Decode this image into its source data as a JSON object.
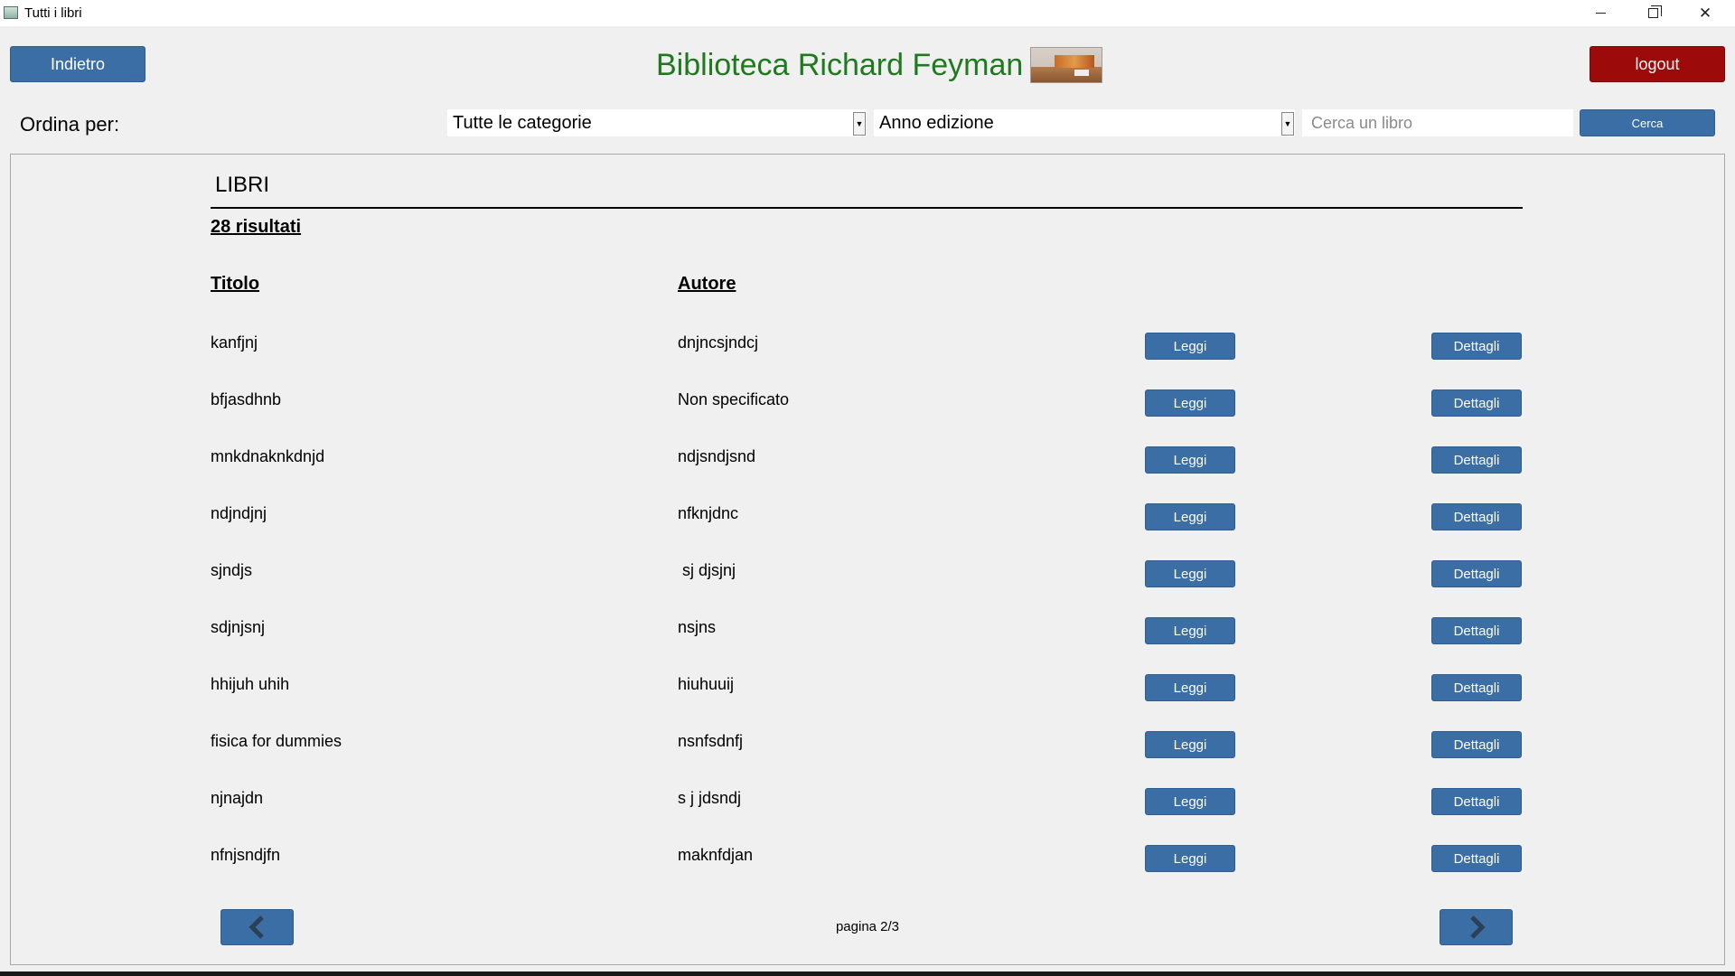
{
  "window": {
    "title": "Tutti i libri",
    "controls": [
      "minimize-icon",
      "maximize-icon",
      "close-icon"
    ]
  },
  "header": {
    "back_label": "Indietro",
    "brand_title": "Biblioteca Richard Feyman",
    "logout_label": "logout"
  },
  "filters": {
    "sort_label": "Ordina per:",
    "category_selected": "Tutte le categorie",
    "year_selected": "Anno edizione",
    "search_placeholder": "Cerca un libro",
    "search_value": "",
    "search_button": "Cerca"
  },
  "list": {
    "section_title": "LIBRI",
    "result_count": "28 risultati",
    "col_title": "Titolo",
    "col_author": "Autore",
    "read_label": "Leggi",
    "details_label": "Dettagli",
    "rows": [
      {
        "title": "kanfjnj",
        "author": "dnjncsjndcj"
      },
      {
        "title": "bfjasdhnb",
        "author": "Non specificato"
      },
      {
        "title": "mnkdnaknkdnjd",
        "author": "ndjsndjsnd"
      },
      {
        "title": "ndjndjnj",
        "author": "nfknjdnc"
      },
      {
        "title": "sjndjs",
        "author": " sj djsjnj"
      },
      {
        "title": "sdjnjsnj",
        "author": "nsjns"
      },
      {
        "title": "hhijuh uhih",
        "author": "hiuhuuij"
      },
      {
        "title": "fisica for dummies",
        "author": "nsnfsdnfj"
      },
      {
        "title": "njnajdn",
        "author": "s j jdsndj"
      },
      {
        "title": "nfnjsndjfn",
        "author": "maknfdjan"
      }
    ]
  },
  "pagination": {
    "page_text": "pagina 2/3",
    "prev_icon": "chevron-left-icon",
    "next_icon": "chevron-right-icon"
  },
  "colors": {
    "primary_button": "#3a6ea5",
    "logout_button": "#9c0a0a",
    "brand_title": "#1f7a1f"
  }
}
